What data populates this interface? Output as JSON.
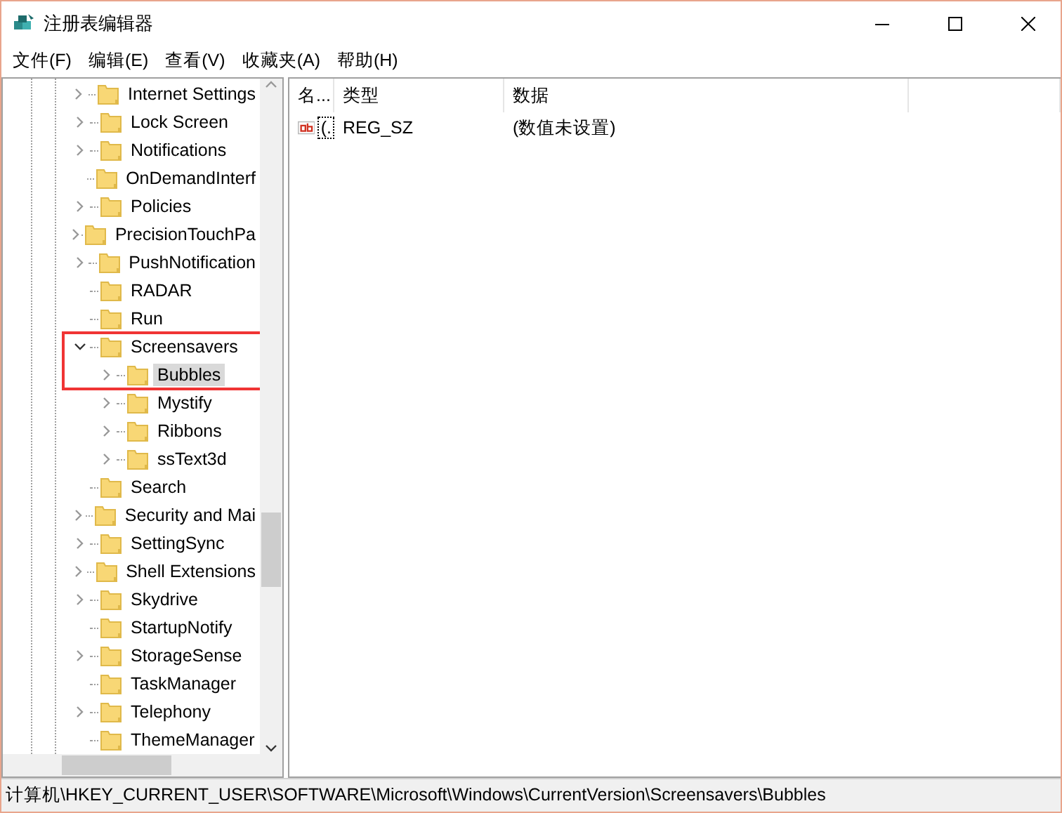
{
  "window": {
    "title": "注册表编辑器"
  },
  "menu": [
    "文件(F)",
    "编辑(E)",
    "查看(V)",
    "收藏夹(A)",
    "帮助(H)"
  ],
  "tree": [
    {
      "label": "Internet Settings",
      "kind": "collapsed",
      "selected": false
    },
    {
      "label": "Lock Screen",
      "kind": "collapsed",
      "selected": false
    },
    {
      "label": "Notifications",
      "kind": "collapsed",
      "selected": false
    },
    {
      "label": "OnDemandInterf",
      "kind": "leaf",
      "selected": false
    },
    {
      "label": "Policies",
      "kind": "collapsed",
      "selected": false
    },
    {
      "label": "PrecisionTouchPa",
      "kind": "collapsed",
      "selected": false
    },
    {
      "label": "PushNotification",
      "kind": "collapsed",
      "selected": false
    },
    {
      "label": "RADAR",
      "kind": "leaf",
      "selected": false
    },
    {
      "label": "Run",
      "kind": "leaf",
      "selected": false
    },
    {
      "label": "Screensavers",
      "kind": "expanded",
      "selected": false,
      "annotated": true,
      "children": [
        {
          "label": "Bubbles",
          "kind": "collapsed",
          "selected": true
        },
        {
          "label": "Mystify",
          "kind": "collapsed",
          "selected": false
        },
        {
          "label": "Ribbons",
          "kind": "collapsed",
          "selected": false
        },
        {
          "label": "ssText3d",
          "kind": "collapsed",
          "selected": false
        }
      ]
    },
    {
      "label": "Search",
      "kind": "leaf",
      "selected": false
    },
    {
      "label": "Security and Mai",
      "kind": "collapsed",
      "selected": false
    },
    {
      "label": "SettingSync",
      "kind": "collapsed",
      "selected": false
    },
    {
      "label": "Shell Extensions",
      "kind": "collapsed",
      "selected": false
    },
    {
      "label": "Skydrive",
      "kind": "collapsed",
      "selected": false
    },
    {
      "label": "StartupNotify",
      "kind": "leaf",
      "selected": false
    },
    {
      "label": "StorageSense",
      "kind": "collapsed",
      "selected": false
    },
    {
      "label": "TaskManager",
      "kind": "leaf",
      "selected": false
    },
    {
      "label": "Telephony",
      "kind": "collapsed",
      "selected": false
    },
    {
      "label": "ThemeManager",
      "kind": "leaf",
      "selected": false
    }
  ],
  "table": {
    "columns": [
      "名...",
      "类型",
      "数据"
    ],
    "rows": [
      {
        "name": "(.",
        "type": "REG_SZ",
        "data": "(数值未设置)"
      }
    ]
  },
  "status_bar": "计算机\\HKEY_CURRENT_USER\\SOFTWARE\\Microsoft\\Windows\\CurrentVersion\\Screensavers\\Bubbles"
}
